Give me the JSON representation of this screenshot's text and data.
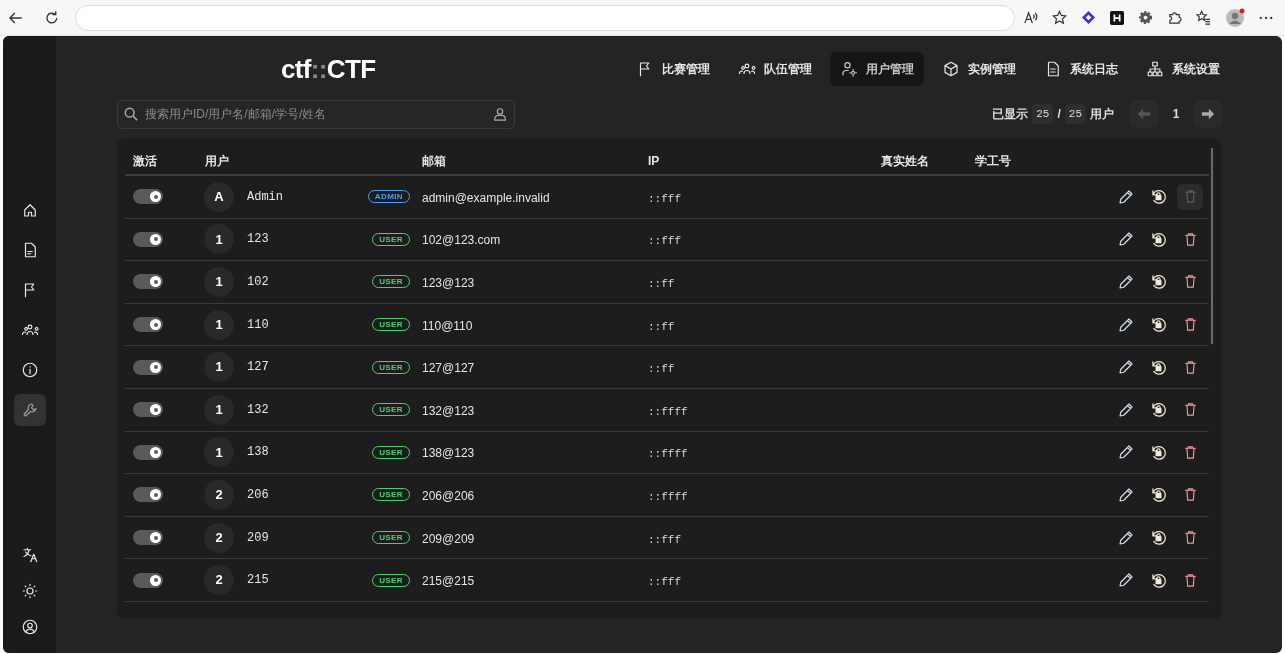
{
  "sidebar": {
    "items": [
      {
        "selected": false
      },
      {
        "selected": false
      },
      {
        "selected": false
      },
      {
        "selected": false
      },
      {
        "selected": false
      },
      {
        "selected": true
      }
    ],
    "footer_items": [
      {
        "selected": false
      },
      {
        "selected": false
      },
      {
        "selected": false
      }
    ]
  },
  "logo": {
    "prefix": "ctf",
    "separator": "::",
    "name": "CTF"
  },
  "nav": [
    {
      "label": "比赛管理",
      "selected": false
    },
    {
      "label": "队伍管理",
      "selected": false
    },
    {
      "label": "用户管理",
      "selected": true
    },
    {
      "label": "实例管理",
      "selected": false
    },
    {
      "label": "系统日志",
      "selected": false
    },
    {
      "label": "系统设置",
      "selected": false
    }
  ],
  "search": {
    "placeholder": "搜索用户ID/用户名/邮箱/学号/姓名"
  },
  "pager": {
    "shown_label": "已显示",
    "shown": "25",
    "separator": "/",
    "total": "25",
    "unit": "用户",
    "page": "1",
    "prev_disabled": true,
    "next_disabled": false
  },
  "table": {
    "columns": [
      "激活",
      "用户",
      "邮箱",
      "IP",
      "真实姓名",
      "学工号"
    ],
    "rows": [
      {
        "active": true,
        "avatar": "A",
        "name": "Admin",
        "role": "ADMIN",
        "color": "#4d9ef7",
        "email": "admin@example.invalid",
        "ip": "::fff",
        "delete_disabled": true
      },
      {
        "active": true,
        "avatar": "1",
        "name": "123",
        "role": "USER",
        "color": "#4ccf6e",
        "email": "102@123.com",
        "ip": "::fff",
        "delete_disabled": false
      },
      {
        "active": true,
        "avatar": "1",
        "name": "102",
        "role": "USER",
        "color": "#4ccf6e",
        "email": "123@123",
        "ip": "::ff",
        "delete_disabled": false
      },
      {
        "active": true,
        "avatar": "1",
        "name": "110",
        "role": "USER",
        "color": "#4ccf6e",
        "email": "110@110",
        "ip": "::ff",
        "delete_disabled": false
      },
      {
        "active": true,
        "avatar": "1",
        "name": "127",
        "role": "USER",
        "color": "#4ccf6e",
        "email": "127@127",
        "ip": "::ff",
        "delete_disabled": false
      },
      {
        "active": true,
        "avatar": "1",
        "name": "132",
        "role": "USER",
        "color": "#4ccf6e",
        "email": "132@123",
        "ip": "::ffff",
        "delete_disabled": false
      },
      {
        "active": true,
        "avatar": "1",
        "name": "138",
        "role": "USER",
        "color": "#4ccf6e",
        "email": "138@123",
        "ip": "::ffff",
        "delete_disabled": false
      },
      {
        "active": true,
        "avatar": "2",
        "name": "206",
        "role": "USER",
        "color": "#4ccf6e",
        "email": "206@206",
        "ip": "::ffff",
        "delete_disabled": false
      },
      {
        "active": true,
        "avatar": "2",
        "name": "209",
        "role": "USER",
        "color": "#4ccf6e",
        "email": "209@209",
        "ip": "::fff",
        "delete_disabled": false
      },
      {
        "active": true,
        "avatar": "2",
        "name": "215",
        "role": "USER",
        "color": "#4ccf6e",
        "email": "215@215",
        "ip": "::fff",
        "delete_disabled": false
      }
    ]
  }
}
